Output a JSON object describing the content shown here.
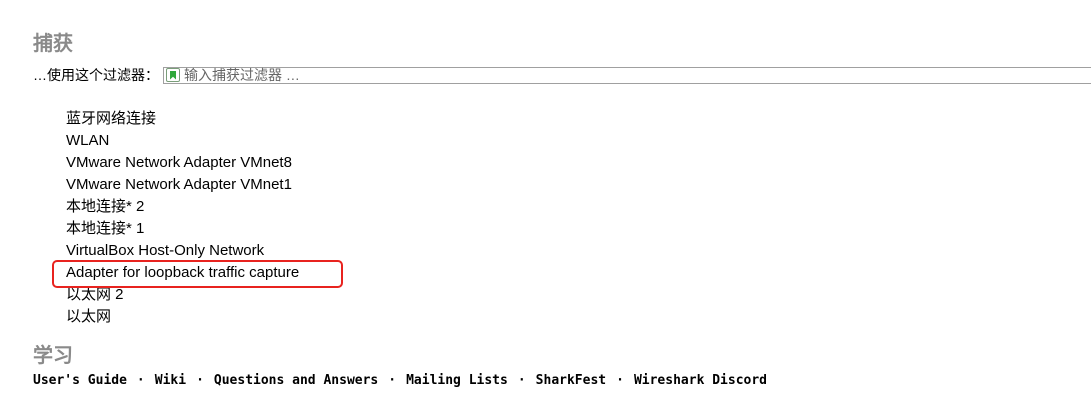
{
  "capture": {
    "title": "捕获",
    "filter_label": "…使用这个过滤器：",
    "filter_placeholder": "输入捕获过滤器 …",
    "interfaces": [
      "蓝牙网络连接",
      "WLAN",
      "VMware Network Adapter VMnet8",
      "VMware Network Adapter VMnet1",
      "本地连接* 2",
      "本地连接* 1",
      "VirtualBox Host-Only Network",
      "Adapter for loopback traffic capture",
      "以太网 2",
      "以太网"
    ],
    "highlighted_interface_index": 7,
    "highlight_color": "#e8231f"
  },
  "learn": {
    "title": "学习",
    "separator": "·",
    "links": [
      "User's Guide",
      "Wiki",
      "Questions and Answers",
      "Mailing Lists",
      "SharkFest",
      "Wireshark Discord"
    ]
  },
  "icons": {
    "filter_bookmark": "bookmark-icon"
  }
}
